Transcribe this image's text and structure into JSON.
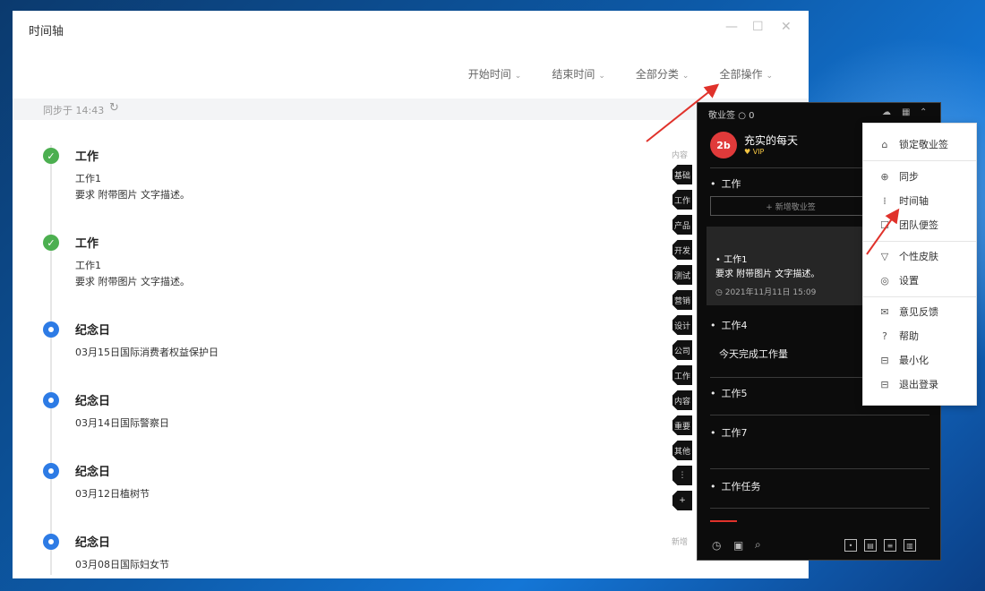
{
  "window": {
    "title": "时间轴",
    "controls": {
      "minimize": "—",
      "maximize": "☐",
      "close": "✕"
    }
  },
  "filters": [
    {
      "label": "开始时间"
    },
    {
      "label": "结束时间"
    },
    {
      "label": "全部分类"
    },
    {
      "label": "全部操作"
    }
  ],
  "sync": {
    "text": "同步于 14:43",
    "refresh_icon": "↻"
  },
  "timeline": [
    {
      "type": "task",
      "title": "工作",
      "lines": [
        "工作1",
        "要求 附带图片 文字描述。"
      ],
      "color": "#4caf50"
    },
    {
      "type": "task",
      "title": "工作",
      "lines": [
        "工作1",
        "要求 附带图片 文字描述。"
      ],
      "color": "#4caf50"
    },
    {
      "type": "anniversary",
      "title": "纪念日",
      "lines": [
        "03月15日国际消费者权益保护日"
      ],
      "color": "#2d7be5"
    },
    {
      "type": "anniversary",
      "title": "纪念日",
      "lines": [
        "03月14日国际警察日"
      ],
      "color": "#2d7be5"
    },
    {
      "type": "anniversary",
      "title": "纪念日",
      "lines": [
        "03月12日植树节"
      ],
      "color": "#2d7be5"
    },
    {
      "type": "anniversary",
      "title": "纪念日",
      "lines": [
        "03月08日国际妇女节"
      ],
      "color": "#2d7be5"
    }
  ],
  "side_strip": {
    "top_label": "内容",
    "bottom_label": "新增",
    "tabs": [
      "基础",
      "工作",
      "产品",
      "开发",
      "测试",
      "营销",
      "设计",
      "公司",
      "工作",
      "内容",
      "重要",
      "其他"
    ],
    "more_icon": "⋮",
    "add_icon": "+"
  },
  "dark_panel": {
    "title": "敬业签",
    "count": "0",
    "user": {
      "avatar_text": "2b",
      "name": "充实的每天",
      "badge": "♥ VIP"
    },
    "sections": [
      {
        "label": "工作"
      },
      {
        "label": "工作4"
      },
      {
        "label": "工作5"
      },
      {
        "label": "工作7"
      },
      {
        "label": "工作任务"
      }
    ],
    "add_button": "+ 新增敬业签",
    "card": {
      "title": "工作1",
      "desc": "要求 附带图片 文字描述。",
      "time": "2021年11月11日 15:09"
    },
    "task_text": "今天完成工作量",
    "bottom_icons": [
      "clock-icon",
      "note-icon",
      "search-icon",
      "pin-icon",
      "calendar-icon",
      "list-icon",
      "doc-icon"
    ]
  },
  "menu": {
    "items": [
      {
        "icon": "⌂",
        "label": "锁定敬业签"
      },
      {
        "icon": "⊕",
        "label": "同步"
      },
      {
        "icon": "⁞",
        "label": "时间轴"
      },
      {
        "icon": "☐",
        "label": "团队便签"
      },
      {
        "icon": "▽",
        "label": "个性皮肤"
      },
      {
        "icon": "◎",
        "label": "设置"
      },
      {
        "icon": "✉",
        "label": "意见反馈"
      },
      {
        "icon": "?",
        "label": "帮助"
      },
      {
        "icon": "⊟",
        "label": "最小化"
      },
      {
        "icon": "⊟",
        "label": "退出登录"
      }
    ]
  },
  "colors": {
    "accent_red": "#e0322b",
    "green": "#4caf50",
    "blue": "#2d7be5"
  }
}
